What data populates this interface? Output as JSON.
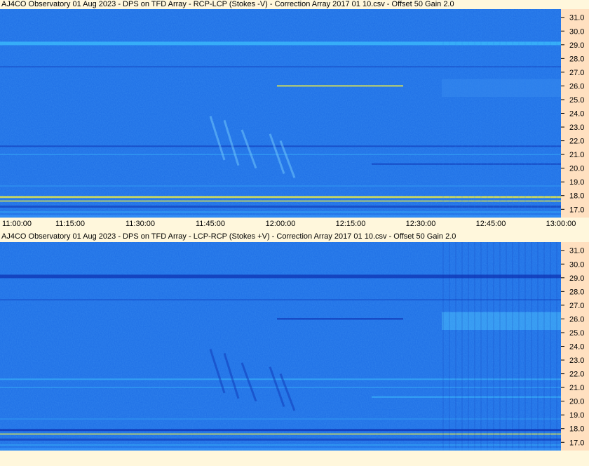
{
  "panels": [
    {
      "title": "AJ4CO Observatory 01 Aug 2023 -  DPS on TFD Array  -  RCP-LCP (Stokes -V)  -  Correction Array 2017 01 10.csv  -  Offset 50  Gain 2.0",
      "mode": "stokes-minus-v"
    },
    {
      "title": "AJ4CO Observatory 01 Aug 2023 -  DPS on TFD Array  -  LCP-RCP (Stokes +V)  -  Correction Array 2017 01 10.csv  -  Offset 50  Gain 2.0",
      "mode": "stokes-plus-v"
    }
  ],
  "chart_data": {
    "type": "heatmap",
    "x_ticks": [
      "11:00:00",
      "11:15:00",
      "11:30:00",
      "11:45:00",
      "12:00:00",
      "12:15:00",
      "12:30:00",
      "12:45:00",
      "13:00:00"
    ],
    "y_ticks": [
      "31.0",
      "30.0",
      "29.0",
      "28.0",
      "27.0",
      "26.0",
      "25.0",
      "24.0",
      "23.0",
      "22.0",
      "21.0",
      "20.0",
      "19.0",
      "18.0",
      "17.0"
    ],
    "ylim": [
      16.4,
      31.6
    ],
    "xlim_minutes": [
      0,
      120
    ],
    "colors": {
      "background": "#1f6fe6",
      "low": "#0d2fb0",
      "high": "#3ec4ff",
      "hot": "#f6f23c",
      "axis_strip": "#fff7dc",
      "freq_strip": "#ffe0c0"
    }
  }
}
